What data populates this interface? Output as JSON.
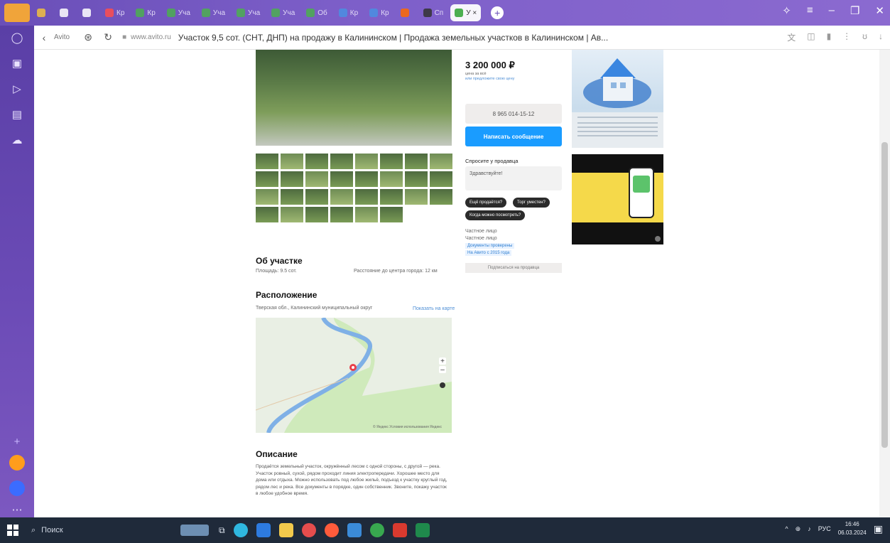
{
  "browser": {
    "tabs": [
      {
        "label": "",
        "color": "#f0c040"
      },
      {
        "label": "",
        "color": "#ffffff"
      },
      {
        "label": "",
        "color": "#ffffff"
      },
      {
        "label": "Кр",
        "color": "#ff4d4d"
      },
      {
        "label": "Кр",
        "color": "#4caf50"
      },
      {
        "label": "Уча",
        "color": "#4caf50"
      },
      {
        "label": "Уча",
        "color": "#4caf50"
      },
      {
        "label": "Уча",
        "color": "#4caf50"
      },
      {
        "label": "Уча",
        "color": "#4caf50"
      },
      {
        "label": "Об",
        "color": "#4caf50"
      },
      {
        "label": "Кр",
        "color": "#4a90e2"
      },
      {
        "label": "Кр",
        "color": "#4a90e2"
      },
      {
        "label": "",
        "color": "#ff6a00"
      },
      {
        "label": "Сп",
        "color": "#333333"
      }
    ],
    "active_tab": {
      "label": "У ×",
      "color": "#4caf50"
    },
    "back_label": "Avito",
    "domain": "www.avito.ru",
    "page_title": "Участок 9,5 сот. (СНТ, ДНП) на продажу в Калининском | Продажа земельных участков в Калининском | Ав..."
  },
  "listing": {
    "price": "3 200 000 ₽",
    "price_note": "цена за всё",
    "price_link": "или предложите свою цену",
    "phone": "8 965 014-15-12",
    "message_button": "Написать сообщение",
    "ask_title": "Спросите у продавца",
    "ask_placeholder": "Здравствуйте!",
    "quick_questions": [
      "Ещё продаётся?",
      "Торг уместен?",
      "Когда можно посмотреть?"
    ],
    "seller_label": "Частное лицо",
    "seller_sub": "Частное лицо",
    "seller_tags": [
      "Документы проверены",
      "На Авито с 2015 года"
    ],
    "subscribe_button": "Подписаться на продавца",
    "about_title": "Об участке",
    "about_area": "Площадь: 9.5 сот.",
    "about_distance": "Расстояние до центра города: 12 км",
    "location_title": "Расположение",
    "location_address": "Тверская обл., Калининский муниципальный округ",
    "location_link": "Показать на карте",
    "map_caption": "© Яндекс Условия использования Яндекс",
    "description_title": "Описание",
    "description_text": "Продаётся земельный участок, окружённый лесом с одной стороны, с другой — река. Участок ровный, сухой, рядом проходит линия электропередачи. Хорошее место для дома или отдыха. Можно использовать под любое жильё, подъезд к участку круглый год, рядом лес и река. Все документы в порядке, один собственник. Звоните, покажу участок в любое удобное время."
  },
  "ads": {
    "ad1_label": "",
    "ad2_label": ""
  },
  "taskbar": {
    "search_placeholder": "Поиск",
    "language": "РУС",
    "time": "16:46",
    "date": "06.03.2024"
  }
}
